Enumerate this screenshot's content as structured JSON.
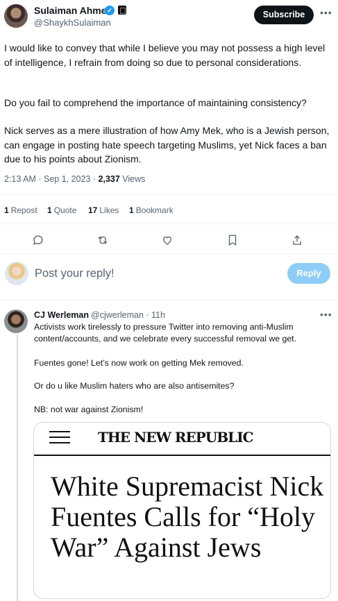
{
  "tweet": {
    "author_name": "Sulaiman Ahmed",
    "author_handle": "@ShaykhSulaiman",
    "subscribe_label": "Subscribe",
    "paragraphs": [
      "I would like to convey that while I believe you may not possess a high level of intelligence, I refrain from doing so due to personal considerations.",
      "Do you fail to comprehend the importance of maintaining consistency?",
      "Nick serves as a mere illustration of how Amy Mek, who is a Jewish person, can engage in posting hate speech targeting Muslims, yet Nick faces a ban due to his points about Zionism."
    ],
    "time": "2:13 AM",
    "date": "Sep 1, 2023",
    "views_count": "2,337",
    "views_label": "Views",
    "stats": [
      {
        "count": "1",
        "label": "Repost"
      },
      {
        "count": "1",
        "label": "Quote"
      },
      {
        "count": "17",
        "label": "Likes"
      },
      {
        "count": "1",
        "label": "Bookmark"
      }
    ]
  },
  "actions": [
    "reply-icon",
    "repost-icon",
    "like-icon",
    "bookmark-icon",
    "share-icon"
  ],
  "composer": {
    "placeholder": "Post your reply!",
    "reply_label": "Reply"
  },
  "reply": {
    "author_name": "CJ Werleman",
    "author_handle": "@cjwerleman",
    "age": "11h",
    "lines": [
      "Activists work tirelessly to pressure Twitter into removing anti-Muslim content/accounts, and we celebrate every successful removal we get.",
      "Fuentes gone! Let’s now work on getting Mek removed.",
      "Or do u like Muslim haters who are also antisemites?",
      "NB: not war against Zionism!"
    ],
    "card": {
      "publication": "THE NEW REPUBLIC",
      "headline": "White Supremacist Nick Fuentes Calls for “Holy War” Against Jews"
    }
  },
  "colors": {
    "accent": "#1d9bf0",
    "reply_button_disabled": "#8ecdf7",
    "secondary_text": "#536471"
  }
}
